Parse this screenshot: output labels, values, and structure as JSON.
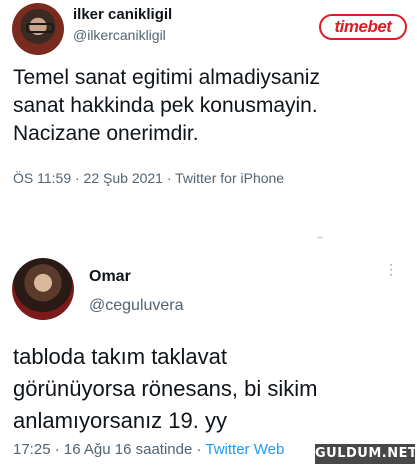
{
  "tweet1": {
    "name": "ilker canikligil",
    "handle": "@ilkercanikligil",
    "text": "Temel sanat egitimi almadiysaniz\nsanat hakkinda pek konusmayin.\nNacizane onerimdir.",
    "meta": "ÖS 11:59 · 22 Şub 2021 · Twitter for iPhone"
  },
  "tweet2": {
    "name": "Omar",
    "handle": "@ceguluvera",
    "more": "⋮",
    "text": "tabloda takım taklavat\ngörünüyorsa rönesans, bi sikim\nanlamıyorsanız 19. yy",
    "meta": "17:25 · 16 Ağu 16 saatinde · ",
    "source": "Twitter Web"
  },
  "watermarks": {
    "brand": "timebet",
    "site": "GULDUM.NET"
  }
}
